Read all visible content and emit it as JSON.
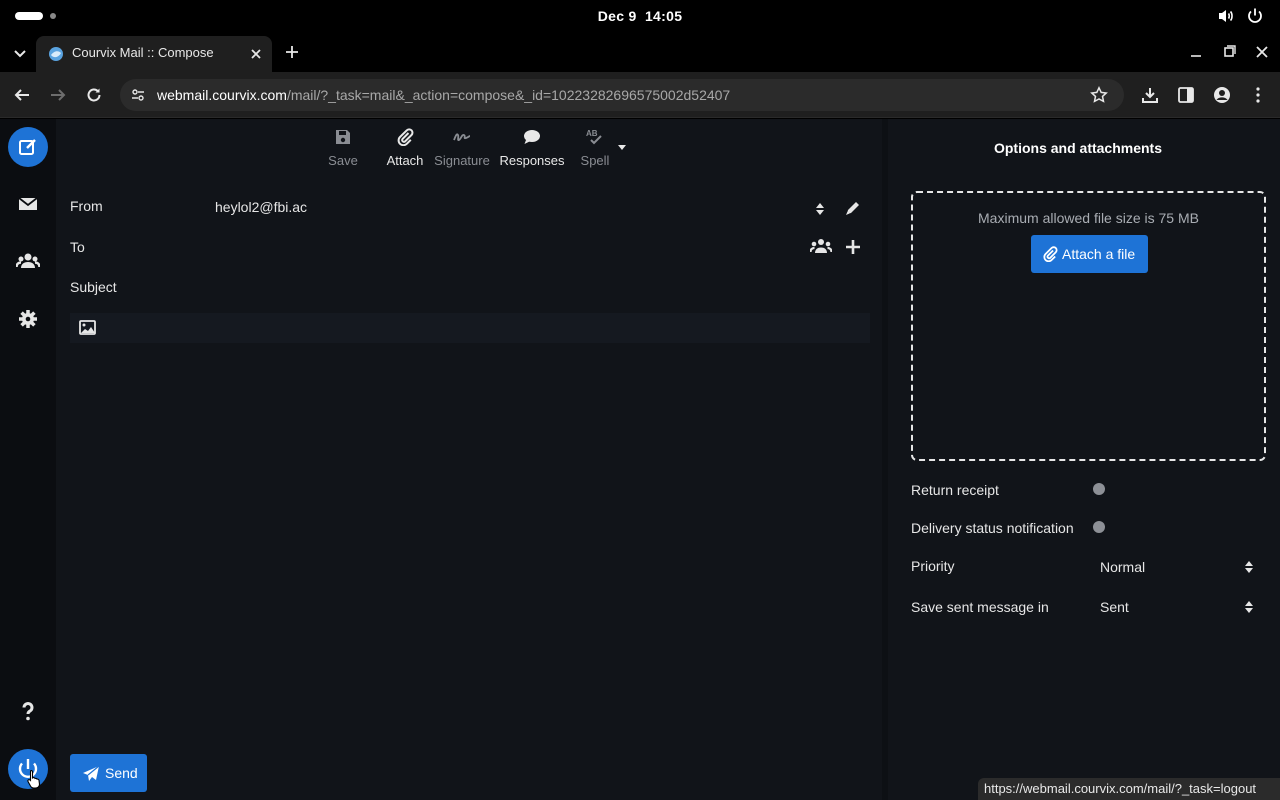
{
  "system": {
    "date": "Dec 9",
    "time": "14:05"
  },
  "browser": {
    "tab_title": "Courvix Mail :: Compose",
    "url_host": "webmail.courvix.com",
    "url_path": "/mail/?_task=mail&_action=compose&_id=10223282696575002d52407",
    "status_url": "https://webmail.courvix.com/mail/?_task=logout"
  },
  "toolbar": {
    "save": "Save",
    "attach": "Attach",
    "signature": "Signature",
    "responses": "Responses",
    "spell": "Spell"
  },
  "compose": {
    "from_label": "From",
    "from_value": "heylol2@fbi.ac",
    "to_label": "To",
    "subject_label": "Subject",
    "send_label": "Send"
  },
  "options": {
    "title": "Options and attachments",
    "max_size_text": "Maximum allowed file size is 75 MB",
    "attach_file_label": "Attach a file",
    "return_receipt_label": "Return receipt",
    "return_receipt_on": false,
    "delivery_status_label": "Delivery status notification",
    "delivery_status_on": false,
    "priority_label": "Priority",
    "priority_value": "Normal",
    "save_sent_label": "Save sent message in",
    "save_sent_value": "Sent"
  },
  "colors": {
    "accent": "#1e73d6",
    "background": "#111419",
    "rail": "#0b0d11"
  }
}
